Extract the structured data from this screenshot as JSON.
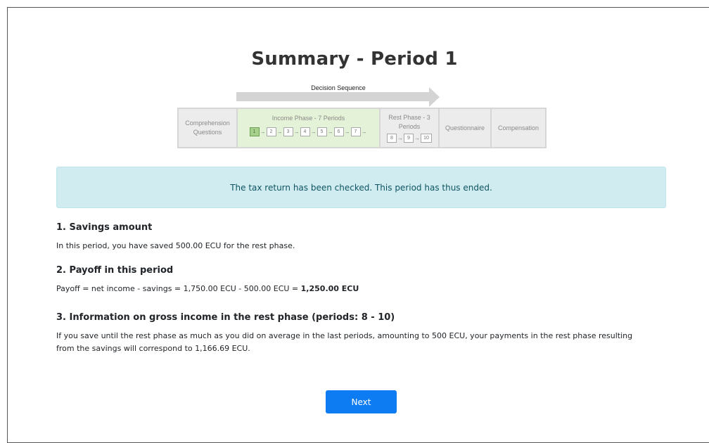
{
  "page": {
    "title": "Summary - Period 1"
  },
  "sequence": {
    "label": "Decision Sequence",
    "comprehension": "Comprehension Questions",
    "income_phase": "Income Phase - 7 Periods",
    "income_periods": [
      "1",
      "2",
      "3",
      "4",
      "5",
      "6",
      "7"
    ],
    "rest_phase": "Rest Phase - 3 Periods",
    "rest_periods": [
      "8",
      "9",
      "10"
    ],
    "questionnaire": "Questionnaire",
    "compensation": "Compensation",
    "arrow_glyph": "→"
  },
  "alert": {
    "text": "The tax return has been checked. This period has thus ended."
  },
  "section1": {
    "heading": "1.  Savings amount",
    "text": "In this period, you have saved 500.00 ECU for the rest phase."
  },
  "section2": {
    "heading": "2.  Payoff in this period",
    "text_prefix": "Payoff = net income - savings = 1,750.00 ECU - 500.00 ECU = ",
    "text_bold": "1,250.00 ECU"
  },
  "section3": {
    "heading": "3.  Information on gross income in the rest phase (periods: 8 - 10)",
    "text": "If you save until the rest phase as much as you did on average in the last periods, amounting to 500 ECU, your payments in the rest phase resulting from the savings will correspond to 1,166.69 ECU."
  },
  "buttons": {
    "next": "Next"
  }
}
